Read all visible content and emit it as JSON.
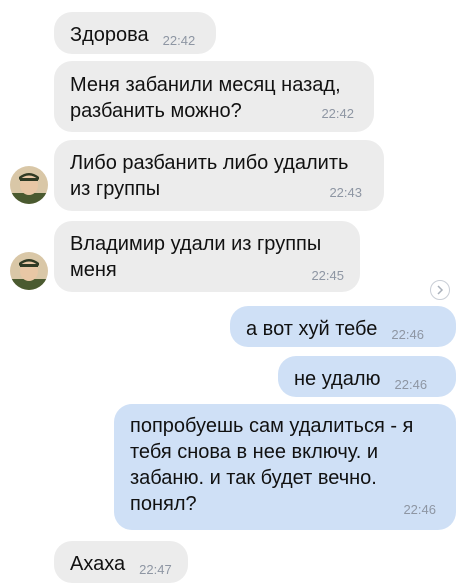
{
  "chat": {
    "messages": [
      {
        "direction": "incoming",
        "text": "Здорова",
        "time": "22:42"
      },
      {
        "direction": "incoming",
        "text": "Меня забанили месяц назад,\nразбанить  можно?",
        "time": "22:42"
      },
      {
        "direction": "incoming",
        "text": "Либо разбанить либо удалить\nиз группы",
        "time": "22:43",
        "avatar": "user-avatar-icon"
      },
      {
        "direction": "incoming",
        "text": "Владимир удали из группы\nменя",
        "time": "22:45",
        "avatar": "user-avatar-icon"
      },
      {
        "direction": "outgoing",
        "text": "а вот хуй тебе",
        "time": "22:46"
      },
      {
        "direction": "outgoing",
        "text": "не удалю",
        "time": "22:46"
      },
      {
        "direction": "outgoing",
        "text": "попробуешь сам удалиться - я\nтебя снова в нее включу. и\nзабаню. и так будет вечно.\nпонял?",
        "time": "22:46"
      },
      {
        "direction": "incoming",
        "text": "Ахаха",
        "time": "22:47"
      }
    ]
  },
  "icons": {
    "scroll": "chevron-right-icon"
  },
  "colors": {
    "incoming_bubble": "#ececec",
    "outgoing_bubble": "#cfe0f6",
    "time_text": "#8e96a3",
    "message_text": "#111111"
  }
}
